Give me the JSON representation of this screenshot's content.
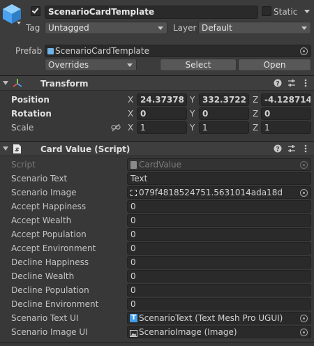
{
  "gameobject": {
    "name": "ScenarioCardTemplate",
    "static_label": "Static",
    "tag_label": "Tag",
    "tag_value": "Untagged",
    "layer_label": "Layer",
    "layer_value": "Default",
    "prefab_label": "Prefab",
    "prefab_value": "ScenarioCardTemplate",
    "overrides_label": "Overrides",
    "select_label": "Select",
    "open_label": "Open",
    "active": true,
    "is_static": false
  },
  "transform": {
    "title": "Transform",
    "position_label": "Position",
    "rotation_label": "Rotation",
    "scale_label": "Scale",
    "axis_x": "X",
    "axis_y": "Y",
    "axis_z": "Z",
    "position": {
      "x": "24.37378",
      "y": "332.3722",
      "z": "-4.128714"
    },
    "rotation": {
      "x": "0",
      "y": "0",
      "z": "0"
    },
    "scale": {
      "x": "1",
      "y": "1",
      "z": "1"
    }
  },
  "card_value": {
    "title": "Card Value (Script)",
    "fields": [
      {
        "label": "Script",
        "value": "CardValue"
      },
      {
        "label": "Scenario Text",
        "value": "Text"
      },
      {
        "label": "Scenario Image",
        "value": "079f4818524751.5631014ada18d"
      },
      {
        "label": "Accept Happiness",
        "value": "0"
      },
      {
        "label": "Accept Wealth",
        "value": "0"
      },
      {
        "label": "Accept Population",
        "value": "0"
      },
      {
        "label": "Accept Environment",
        "value": "0"
      },
      {
        "label": "Decline Happiness",
        "value": "0"
      },
      {
        "label": "Decline Wealth",
        "value": "0"
      },
      {
        "label": "Decline Population",
        "value": "0"
      },
      {
        "label": "Decline Environment",
        "value": "0"
      },
      {
        "label": "Scenario Text UI",
        "value": "ScenarioText (Text Mesh Pro UGUI)"
      },
      {
        "label": "Scenario Image UI",
        "value": "ScenarioImage (Image)"
      }
    ]
  },
  "colors": {
    "background": "#383838",
    "field": "#2a2a2a",
    "header": "#3e3e3e",
    "cube_icon": "#4aa3f0",
    "tmp_icon": "#3f9ee8"
  },
  "icons": [
    "gameobject-cube-icon",
    "prefab-icon",
    "transform-icon",
    "script-icon",
    "help-icon",
    "preset-icon",
    "menu-icon",
    "link-icon",
    "target-icon"
  ]
}
